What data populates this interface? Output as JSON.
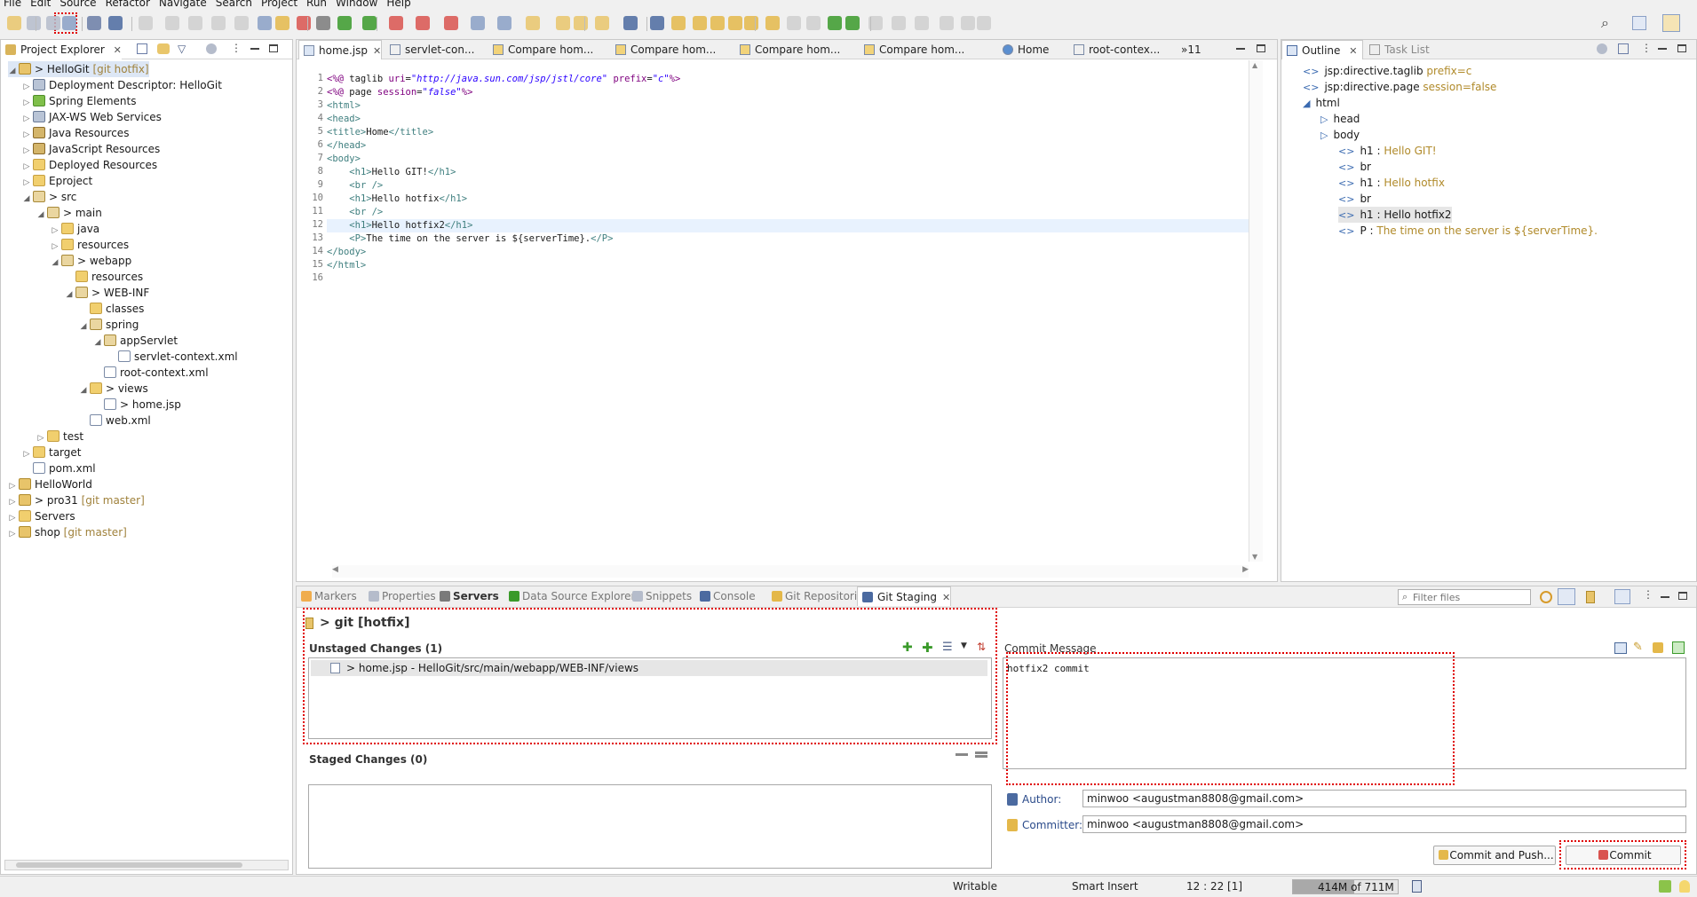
{
  "menu": [
    "File",
    "Edit",
    "Source",
    "Refactor",
    "Navigate",
    "Search",
    "Project",
    "Run",
    "Window",
    "Help"
  ],
  "project_explorer": {
    "title": "Project Explorer",
    "items": [
      {
        "label": "> HelloGit",
        "git": "[git hotfix]",
        "depth": 0,
        "tw": "◢",
        "icon": "proj"
      },
      {
        "label": "Deployment Descriptor: HelloGit",
        "git": "",
        "depth": 1,
        "tw": "▷",
        "icon": "web"
      },
      {
        "label": "Spring Elements",
        "git": "",
        "depth": 1,
        "tw": "▷",
        "icon": "spr"
      },
      {
        "label": "JAX-WS Web Services",
        "git": "",
        "depth": 1,
        "tw": "▷",
        "icon": "web"
      },
      {
        "label": "Java Resources",
        "git": "",
        "depth": 1,
        "tw": "▷",
        "icon": "java"
      },
      {
        "label": "JavaScript Resources",
        "git": "",
        "depth": 1,
        "tw": "▷",
        "icon": "java"
      },
      {
        "label": "Deployed Resources",
        "git": "",
        "depth": 1,
        "tw": "▷",
        "icon": "fold"
      },
      {
        "label": "Eproject",
        "git": "",
        "depth": 1,
        "tw": "▷",
        "icon": "fold"
      },
      {
        "label": "> src",
        "git": "",
        "depth": 1,
        "tw": "◢",
        "icon": "pkg"
      },
      {
        "label": "> main",
        "git": "",
        "depth": 2,
        "tw": "◢",
        "icon": "pkg"
      },
      {
        "label": "java",
        "git": "",
        "depth": 3,
        "tw": "▷",
        "icon": "fold"
      },
      {
        "label": "resources",
        "git": "",
        "depth": 3,
        "tw": "▷",
        "icon": "fold"
      },
      {
        "label": "> webapp",
        "git": "",
        "depth": 3,
        "tw": "◢",
        "icon": "pkg"
      },
      {
        "label": "resources",
        "git": "",
        "depth": 4,
        "tw": "",
        "icon": "fold"
      },
      {
        "label": "> WEB-INF",
        "git": "",
        "depth": 4,
        "tw": "◢",
        "icon": "pkg"
      },
      {
        "label": "classes",
        "git": "",
        "depth": 5,
        "tw": "",
        "icon": "fold"
      },
      {
        "label": "spring",
        "git": "",
        "depth": 5,
        "tw": "◢",
        "icon": "pkg"
      },
      {
        "label": "appServlet",
        "git": "",
        "depth": 6,
        "tw": "◢",
        "icon": "pkg"
      },
      {
        "label": "servlet-context.xml",
        "git": "",
        "depth": 7,
        "tw": "",
        "icon": "file"
      },
      {
        "label": "root-context.xml",
        "git": "",
        "depth": 6,
        "tw": "",
        "icon": "file"
      },
      {
        "label": "> views",
        "git": "",
        "depth": 5,
        "tw": "◢",
        "icon": "fold"
      },
      {
        "label": "> home.jsp",
        "git": "",
        "depth": 6,
        "tw": "",
        "icon": "file"
      },
      {
        "label": "web.xml",
        "git": "",
        "depth": 5,
        "tw": "",
        "icon": "file"
      },
      {
        "label": "test",
        "git": "",
        "depth": 2,
        "tw": "▷",
        "icon": "fold"
      },
      {
        "label": "target",
        "git": "",
        "depth": 1,
        "tw": "▷",
        "icon": "fold"
      },
      {
        "label": "pom.xml",
        "git": "",
        "depth": 1,
        "tw": "",
        "icon": "file"
      },
      {
        "label": "HelloWorld",
        "git": "",
        "depth": 0,
        "tw": "▷",
        "icon": "proj"
      },
      {
        "label": "> pro31",
        "git": "[git master]",
        "depth": 0,
        "tw": "▷",
        "icon": "proj"
      },
      {
        "label": "Servers",
        "git": "",
        "depth": 0,
        "tw": "▷",
        "icon": "fold"
      },
      {
        "label": "shop",
        "git": "[git master]",
        "depth": 0,
        "tw": "▷",
        "icon": "proj"
      }
    ]
  },
  "editor": {
    "tabs": [
      "home.jsp",
      "servlet-con...",
      "Compare hom...",
      "Compare hom...",
      "Compare hom...",
      "Compare hom...",
      "Home",
      "root-contex...",
      "»11"
    ],
    "lines": [
      "<%@ taglib uri=\"http://java.sun.com/jsp/jstl/core\" prefix=\"c\"%>",
      "<%@ page session=\"false\"%>",
      "<html>",
      "<head>",
      "<title>Home</title>",
      "</head>",
      "<body>",
      "    <h1>Hello GIT!</h1>",
      "    <br />",
      "    <h1>Hello hotfix</h1>",
      "    <br />",
      "    <h1>Hello hotfix2</h1>",
      "    <P>The time on the server is ${serverTime}.</P>",
      "</body>",
      "</html>",
      ""
    ]
  },
  "outline": {
    "tabs": [
      "Outline",
      "Task List"
    ],
    "items": [
      {
        "label": "jsp:directive.taglib",
        "extra": "prefix=c",
        "depth": 0
      },
      {
        "label": "jsp:directive.page",
        "extra": "session=false",
        "depth": 0
      },
      {
        "label": "html",
        "extra": "",
        "depth": 0
      },
      {
        "label": "head",
        "extra": "",
        "depth": 1
      },
      {
        "label": "body",
        "extra": "",
        "depth": 1
      },
      {
        "label": "h1 :",
        "extra": "Hello GIT!",
        "depth": 2
      },
      {
        "label": "br",
        "extra": "",
        "depth": 2
      },
      {
        "label": "h1 :",
        "extra": "Hello hotfix",
        "depth": 2
      },
      {
        "label": "br",
        "extra": "",
        "depth": 2
      },
      {
        "label": "h1 : Hello hotfix2",
        "extra": "",
        "depth": 2
      },
      {
        "label": "P :",
        "extra": "The time on the server is ${serverTime}.",
        "depth": 2
      }
    ]
  },
  "bottom": {
    "tabs": [
      "Markers",
      "Properties",
      "Servers",
      "Data Source Explorer",
      "Snippets",
      "Console",
      "Git Repositories",
      "Git Staging"
    ],
    "filter_placeholder": "Filter files",
    "repo_title": "> git [hotfix]",
    "unstaged_title": "Unstaged Changes (1)",
    "unstaged_items": [
      "> home.jsp - HelloGit/src/main/webapp/WEB-INF/views"
    ],
    "staged_title": "Staged Changes (0)",
    "commit_message_title": "Commit Message",
    "commit_message": "hotfix2 commit",
    "author_label": "Author:",
    "author_value": "minwoo <augustman8808@gmail.com>",
    "committer_label": "Committer:",
    "committer_value": "minwoo <augustman8808@gmail.com>",
    "commit_push_label": "Commit and Push...",
    "commit_label": "Commit"
  },
  "status": {
    "writable": "Writable",
    "insert_mode": "Smart Insert",
    "position": "12 : 22 [1]",
    "memory": "414M of 711M"
  }
}
